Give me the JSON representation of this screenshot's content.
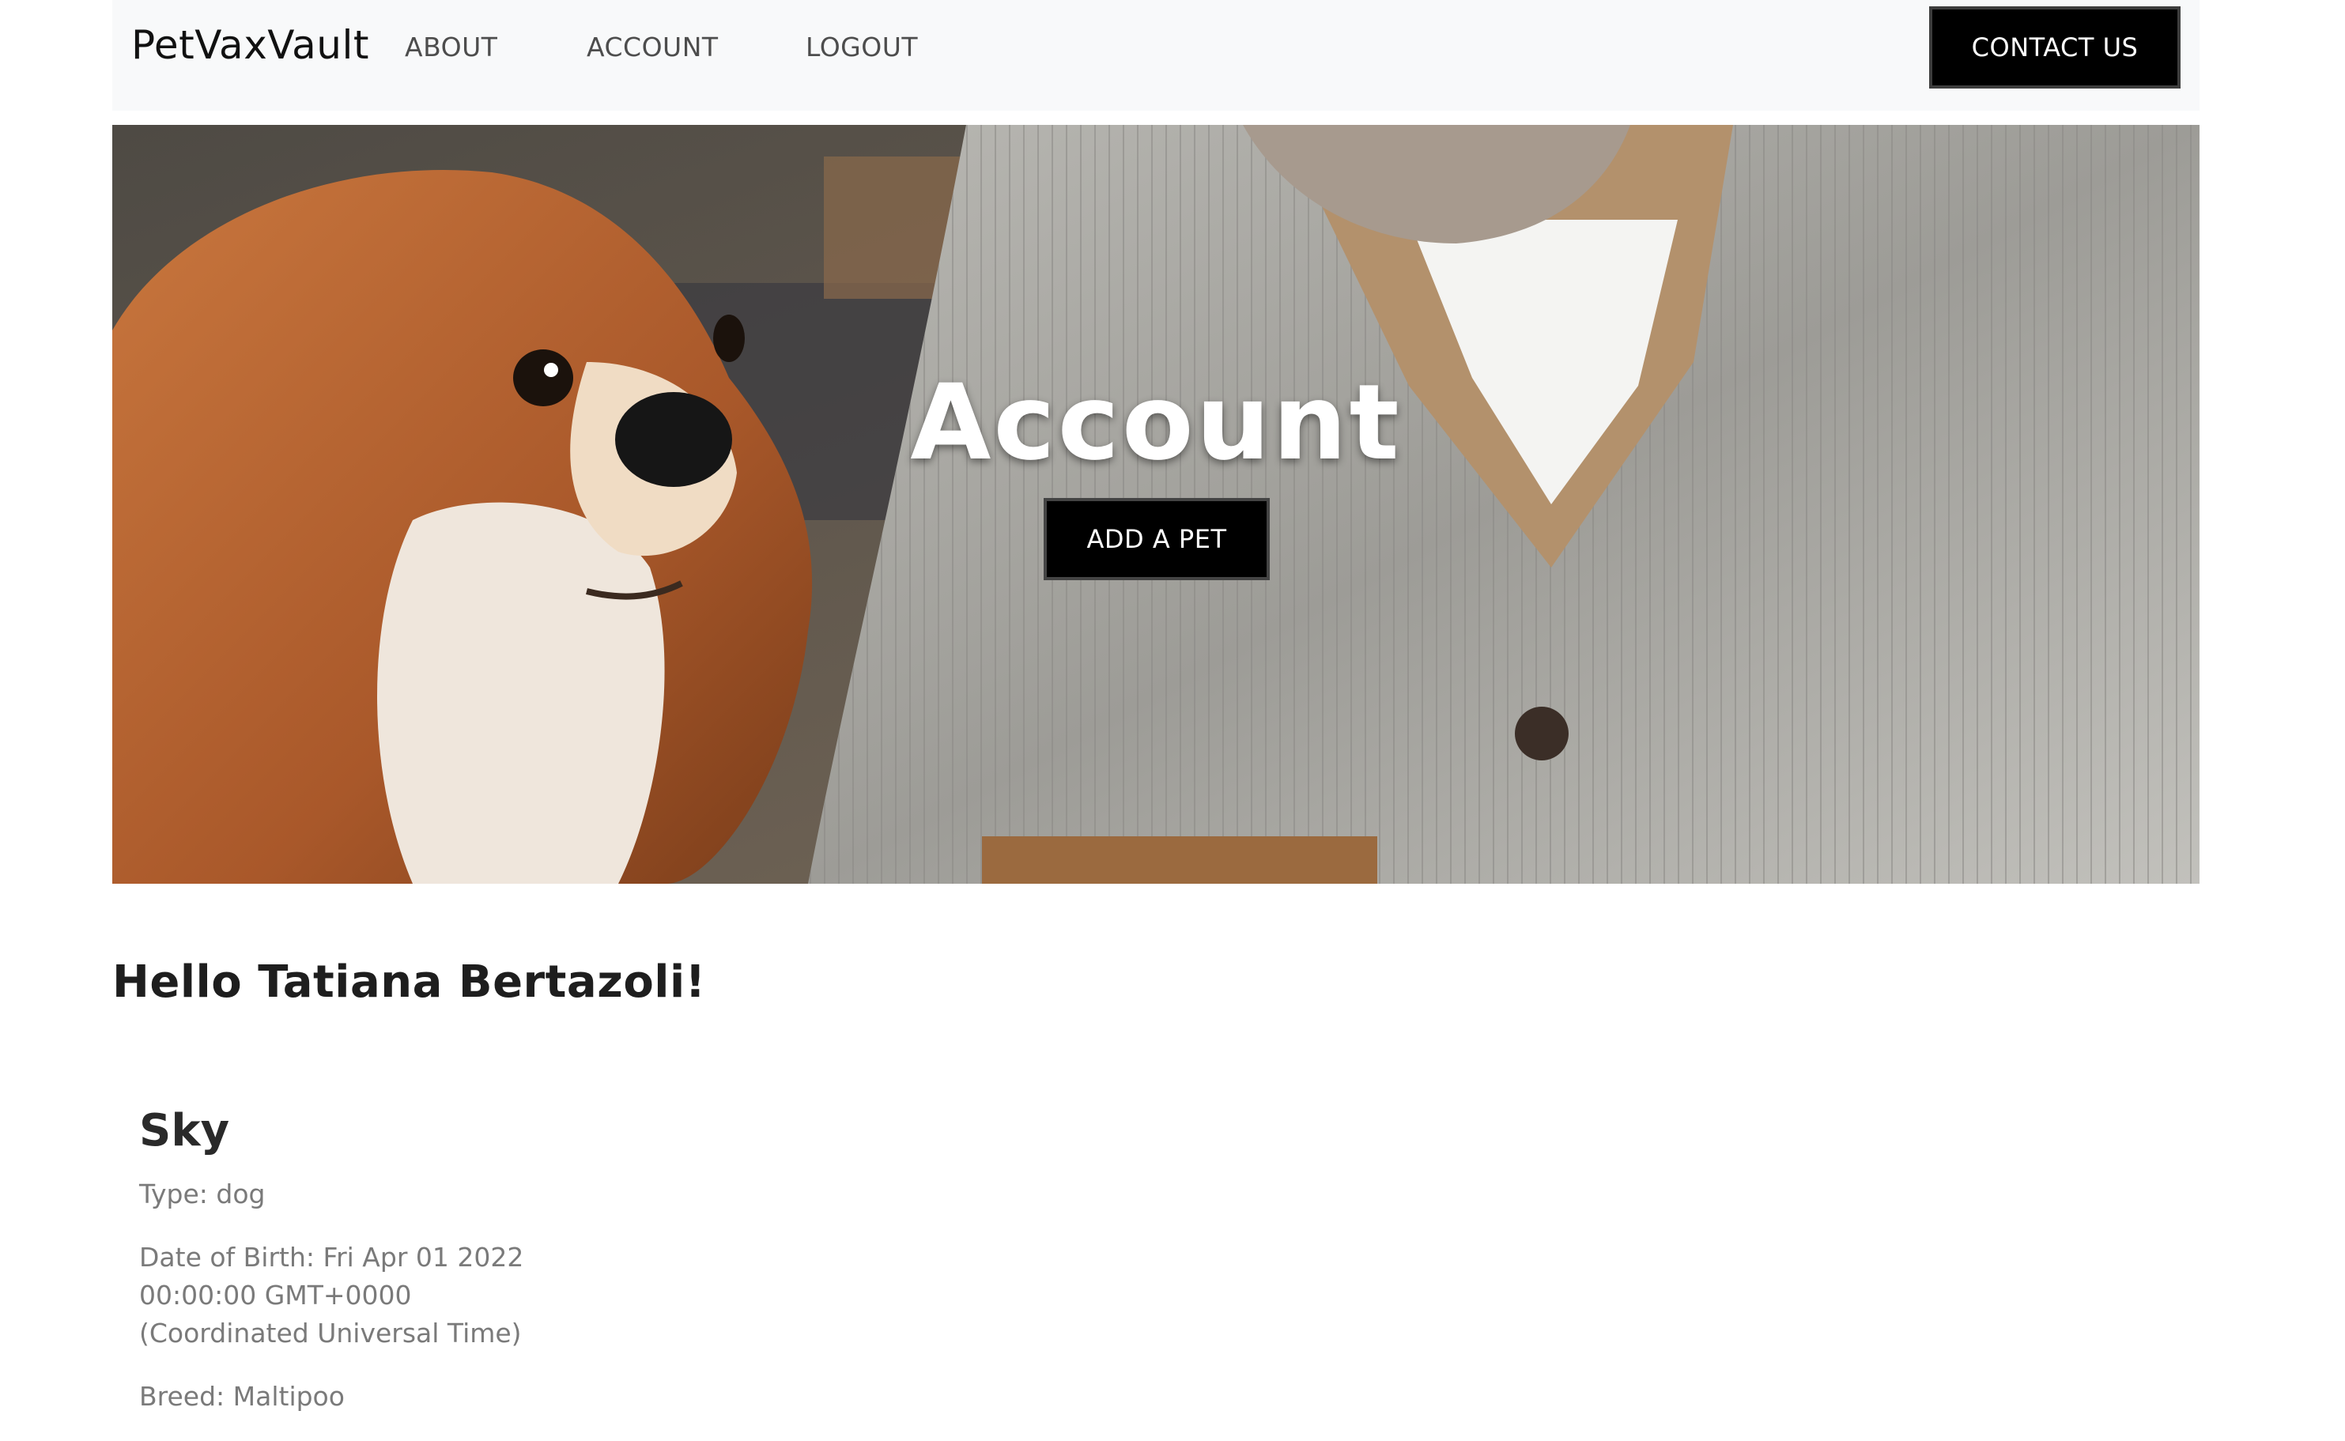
{
  "navbar": {
    "brand": "PetVaxVault",
    "links": [
      {
        "label": "ABOUT"
      },
      {
        "label": "ACCOUNT"
      },
      {
        "label": "LOGOUT"
      }
    ],
    "contact_label": "CONTACT US",
    "background": "#f8f9fa"
  },
  "hero": {
    "title": "Account",
    "add_pet_label": "ADD A PET",
    "image_subject": "dog-and-man-photo"
  },
  "main": {
    "greeting": "Hello Tatiana Bertazoli!",
    "pets": [
      {
        "name": "Sky",
        "type": "Type: dog",
        "dob_line1": "Date of Birth: Fri Apr 01 2022",
        "dob_line2": "00:00:00 GMT+0000",
        "dob_line3": "(Coordinated Universal Time)",
        "breed": "Breed: Maltipoo"
      }
    ]
  },
  "colors": {
    "button_bg": "#000000",
    "button_text": "#ffffff",
    "muted_text": "#7a7a7a"
  }
}
